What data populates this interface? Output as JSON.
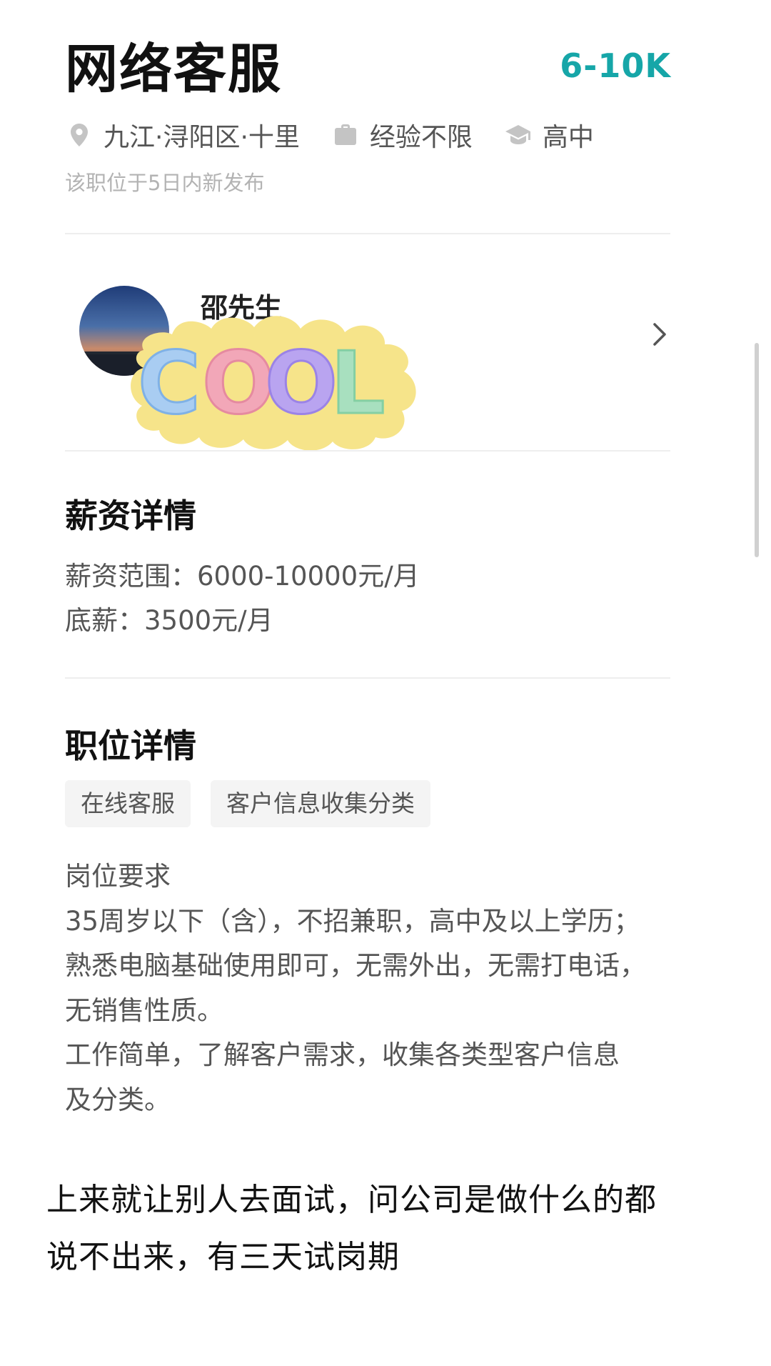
{
  "job": {
    "title": "网络客服",
    "salary": "6-10K",
    "location": "九江·浔阳区·十里",
    "experience": "经验不限",
    "education": "高中",
    "posted_note": "该职位于5日内新发布"
  },
  "recruiter": {
    "name": "邵先生",
    "sticker_text": "COOL"
  },
  "salary_details": {
    "title": "薪资详情",
    "range_label": "薪资范围：6000-10000元/月",
    "base_label": "底薪：3500元/月"
  },
  "position_details": {
    "title": "职位详情",
    "tags": [
      "在线客服",
      "客户信息收集分类"
    ],
    "requirements": [
      "岗位要求",
      "35周岁以下（含），不招兼职，高中及以上学历；",
      "熟悉电脑基础使用即可，无需外出，无需打电话，",
      "无销售性质。",
      "工作简单，了解客户需求，收集各类型客户信息",
      "及分类。"
    ]
  },
  "caption": [
    "上来就让别人去面试，问公司是做什么的都",
    "说不出来，有三天试岗期"
  ],
  "icons": {
    "location": "location-pin-icon",
    "experience": "briefcase-icon",
    "education": "graduation-cap-icon",
    "chevron": "chevron-right-icon"
  },
  "colors": {
    "salary_accent": "#16a6a8",
    "muted_text": "#555555",
    "faint_text": "#b3b3b3",
    "tag_bg": "#f4f4f4"
  }
}
